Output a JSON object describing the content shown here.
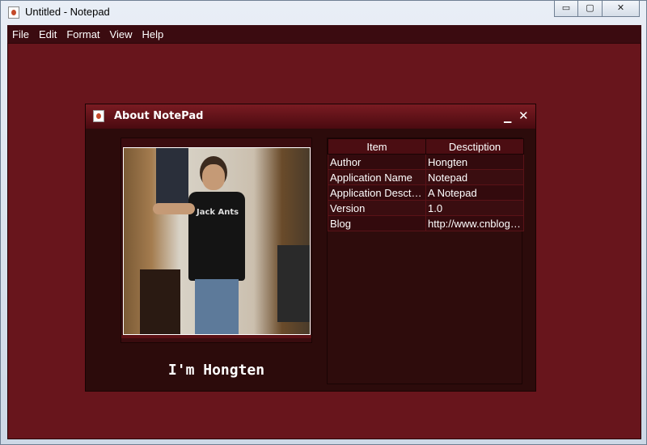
{
  "window": {
    "title": "Untitled - Notepad",
    "controls": {
      "minimize": "▭",
      "maximize": "▢",
      "close": "✕"
    }
  },
  "menu": [
    "File",
    "Edit",
    "Format",
    "View",
    "Help"
  ],
  "dialog": {
    "title": "About NotePad",
    "minimize": "▁",
    "close": "✕",
    "caption": "I'm Hongten",
    "photo_text": "Jack Ants",
    "table": {
      "headers": [
        "Item",
        "Desctiption"
      ],
      "rows": [
        [
          "Author",
          "Hongten"
        ],
        [
          "Application Name",
          "Notepad"
        ],
        [
          "Application Desctiption",
          "A Notepad"
        ],
        [
          "Version",
          "1.0"
        ],
        [
          "Blog",
          "http://www.cnblogs.com/hongten"
        ]
      ]
    }
  },
  "colors": {
    "desktop": "#68151c",
    "menubar": "#3b0b10",
    "dialog": "#2c0b0b"
  }
}
